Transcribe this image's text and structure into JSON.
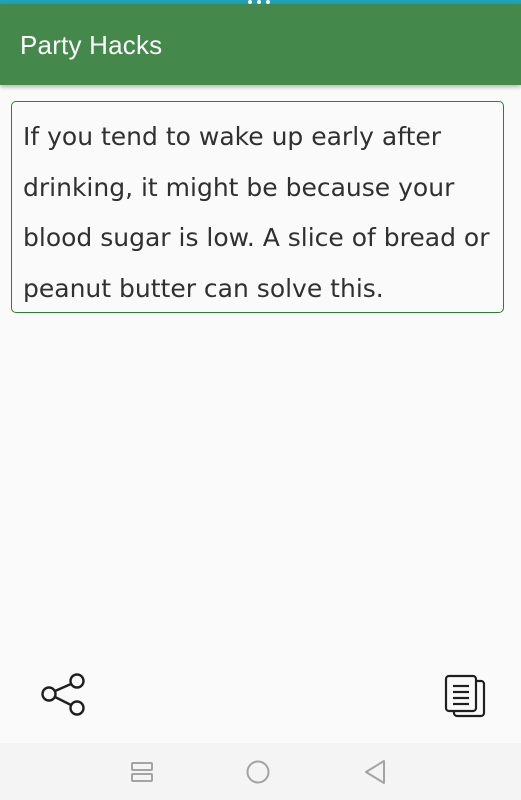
{
  "app": {
    "title": "Party Hacks"
  },
  "hack": {
    "text": "If you tend to wake up early after drinking, it might be because your blood sugar is low. A slice of bread or peanut butter can solve this."
  },
  "actions": {
    "share_icon": "share-icon",
    "copy_icon": "copy-icon"
  },
  "navigation": {
    "recents_icon": "recents-icon",
    "home_icon": "home-icon",
    "back_icon": "back-icon"
  },
  "colors": {
    "app_bar": "#44894b",
    "status_strip": "#1fa2b8",
    "card_border": "#2e7d32",
    "text": "#303030",
    "background": "#fafafa"
  }
}
